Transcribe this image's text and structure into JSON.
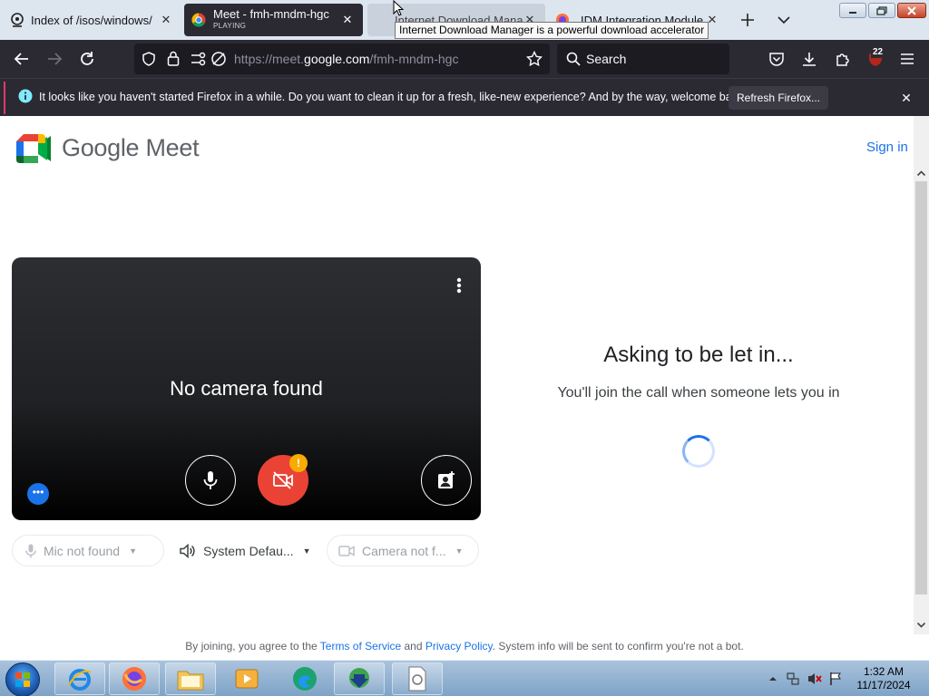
{
  "browser": {
    "tabs": [
      {
        "title": "Index of /isos/windows/",
        "subtitle": ""
      },
      {
        "title": "Meet - fmh-mndm-hgc",
        "subtitle": "PLAYING"
      },
      {
        "title": "Internet Download Mana",
        "subtitle": ""
      },
      {
        "title": "IDM Integration Module",
        "subtitle": ""
      }
    ],
    "tooltip": "Internet Download Manager is a powerful download accelerator",
    "url_prefix": "https://meet.",
    "url_domain": "google.com",
    "url_path": "/fmh-mndm-hgc",
    "search_placeholder": "Search",
    "extensions_badge": "22",
    "notification": {
      "text": "It looks like you haven't started Firefox in a while. Do you want to clean it up for a fresh, like-new experience? And by the way, welcome back!",
      "button": "Refresh Firefox..."
    }
  },
  "meet": {
    "brand_google": "Google",
    "brand_meet": "Meet",
    "sign_in": "Sign in",
    "preview_message": "No camera found",
    "warning_glyph": "!",
    "devices": {
      "mic": "Mic not found",
      "speaker": "System Defau...",
      "camera": "Camera not f..."
    },
    "status_title": "Asking to be let in...",
    "status_subtitle": "You'll join the call when someone lets you in",
    "footer": {
      "prefix": "By joining, you agree to the",
      "terms": "Terms of Service",
      "and": "and",
      "privacy": "Privacy Policy",
      "suffix": ". System info will be sent to confirm you're not a bot."
    }
  },
  "taskbar": {
    "time": "1:32 AM",
    "date": "11/17/2024",
    "apps": [
      "internet-explorer",
      "firefox",
      "file-explorer",
      "media-player",
      "edge",
      "internet-download-manager",
      "document"
    ]
  }
}
